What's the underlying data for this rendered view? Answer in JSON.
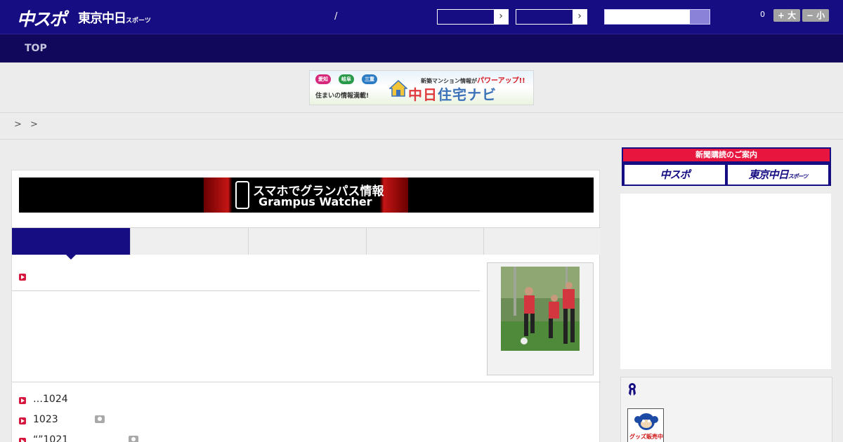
{
  "header": {
    "logo_primary": "中スポ",
    "logo_secondary": "東京中日",
    "logo_secondary_sub": "スポーツ",
    "date_separator": "/",
    "font_size_value": "0",
    "font_up_label": "+ 大",
    "font_down_label": "− 小"
  },
  "nav": {
    "top_label": "TOP"
  },
  "ad": {
    "tags": [
      "愛知",
      "岐阜",
      "三重"
    ],
    "sub_text": "住まいの情報満載!",
    "top_text": "新築マンション情報が",
    "top_highlight": "パワーアップ!!",
    "main_a": "中日",
    "main_b": "住宅ナビ"
  },
  "breadcrumb": {
    "text": "> >"
  },
  "grampus_banner": {
    "line1": "スマホでグランパス情報",
    "line2": "Grampus Watcher"
  },
  "news": [
    {
      "title": "…1024",
      "has_photo": false
    },
    {
      "title": "1023",
      "has_photo": true
    },
    {
      "title": "“”1021",
      "has_photo": true
    }
  ],
  "sidebar": {
    "subscribe_head": "新聞購読のご案内",
    "subscribe_left": "中スポ",
    "subscribe_right": "東京中日",
    "subscribe_right_sub": "スポーツ",
    "goods_label": "グッズ販売中"
  },
  "colors": {
    "brand_navy": "#160d83",
    "nav_dark": "#11085c",
    "accent_red": "#d6163c",
    "subscribe_red": "#e8163f"
  }
}
